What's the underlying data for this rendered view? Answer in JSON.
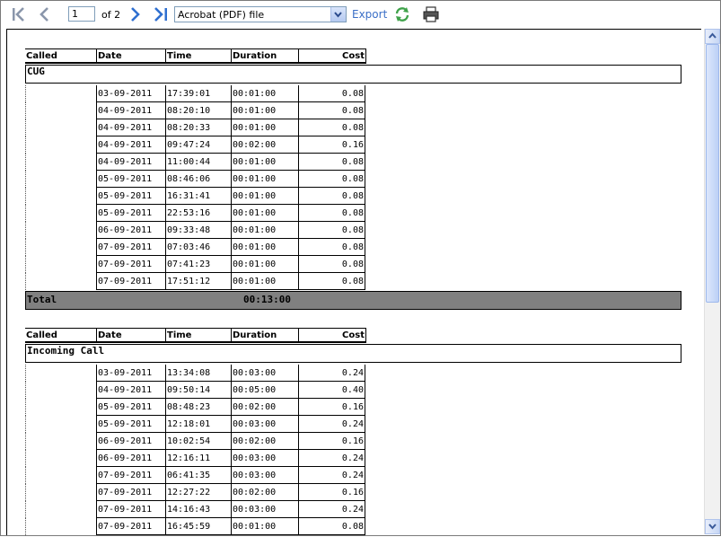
{
  "toolbar": {
    "page_current": "1",
    "page_of": "of 2",
    "format_selected": "Acrobat (PDF) file",
    "export_label": "Export"
  },
  "report": {
    "headers": {
      "called": "Called",
      "date": "Date",
      "time": "Time",
      "duration": "Duration",
      "cost": "Cost"
    },
    "sections": [
      {
        "title": "CUG",
        "rows": [
          {
            "date": "03-09-2011",
            "time": "17:39:01",
            "duration": "00:01:00",
            "cost": "0.08"
          },
          {
            "date": "04-09-2011",
            "time": "08:20:10",
            "duration": "00:01:00",
            "cost": "0.08"
          },
          {
            "date": "04-09-2011",
            "time": "08:20:33",
            "duration": "00:01:00",
            "cost": "0.08"
          },
          {
            "date": "04-09-2011",
            "time": "09:47:24",
            "duration": "00:02:00",
            "cost": "0.16"
          },
          {
            "date": "04-09-2011",
            "time": "11:00:44",
            "duration": "00:01:00",
            "cost": "0.08"
          },
          {
            "date": "05-09-2011",
            "time": "08:46:06",
            "duration": "00:01:00",
            "cost": "0.08"
          },
          {
            "date": "05-09-2011",
            "time": "16:31:41",
            "duration": "00:01:00",
            "cost": "0.08"
          },
          {
            "date": "05-09-2011",
            "time": "22:53:16",
            "duration": "00:01:00",
            "cost": "0.08"
          },
          {
            "date": "06-09-2011",
            "time": "09:33:48",
            "duration": "00:01:00",
            "cost": "0.08"
          },
          {
            "date": "07-09-2011",
            "time": "07:03:46",
            "duration": "00:01:00",
            "cost": "0.08"
          },
          {
            "date": "07-09-2011",
            "time": "07:41:23",
            "duration": "00:01:00",
            "cost": "0.08"
          },
          {
            "date": "07-09-2011",
            "time": "17:51:12",
            "duration": "00:01:00",
            "cost": "0.08"
          }
        ],
        "total_label": "Total",
        "total_duration": "00:13:00"
      },
      {
        "title": "Incoming Call",
        "rows": [
          {
            "date": "03-09-2011",
            "time": "13:34:08",
            "duration": "00:03:00",
            "cost": "0.24"
          },
          {
            "date": "04-09-2011",
            "time": "09:50:14",
            "duration": "00:05:00",
            "cost": "0.40"
          },
          {
            "date": "05-09-2011",
            "time": "08:48:23",
            "duration": "00:02:00",
            "cost": "0.16"
          },
          {
            "date": "05-09-2011",
            "time": "12:18:01",
            "duration": "00:03:00",
            "cost": "0.24"
          },
          {
            "date": "06-09-2011",
            "time": "10:02:54",
            "duration": "00:02:00",
            "cost": "0.16"
          },
          {
            "date": "06-09-2011",
            "time": "12:16:11",
            "duration": "00:03:00",
            "cost": "0.24"
          },
          {
            "date": "07-09-2011",
            "time": "06:41:35",
            "duration": "00:03:00",
            "cost": "0.24"
          },
          {
            "date": "07-09-2011",
            "time": "12:27:22",
            "duration": "00:02:00",
            "cost": "0.16"
          },
          {
            "date": "07-09-2011",
            "time": "14:16:43",
            "duration": "00:03:00",
            "cost": "0.24"
          },
          {
            "date": "07-09-2011",
            "time": "16:45:59",
            "duration": "00:01:00",
            "cost": "0.08"
          }
        ]
      }
    ]
  },
  "colors": {
    "toolbar_arrow": "#8a96ab",
    "nav_arrow_active": "#2f6fd0",
    "export_link": "#3b6fc7",
    "total_bar": "#808080"
  },
  "icons": [
    "first-page-icon",
    "previous-page-icon",
    "next-page-icon",
    "last-page-icon",
    "refresh-icon",
    "print-icon"
  ]
}
